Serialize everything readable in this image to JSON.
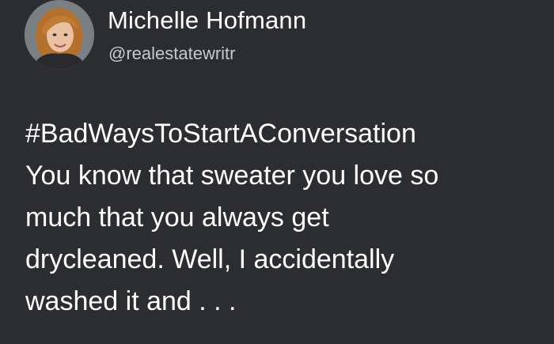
{
  "user": {
    "display_name": "Michelle Hofmann",
    "handle": "@realestatewritr",
    "avatar_icon": "user-avatar-photo"
  },
  "tweet": {
    "hashtag": "#BadWaysToStartAConversation",
    "lines": [
      "You know that sweater you love so",
      "much that you always get",
      "drycleaned. Well, I accidentally",
      "washed it and . . ."
    ]
  },
  "colors": {
    "background": "#2b2d30",
    "text": "#ffffff",
    "handle": "#c7c9cc"
  }
}
